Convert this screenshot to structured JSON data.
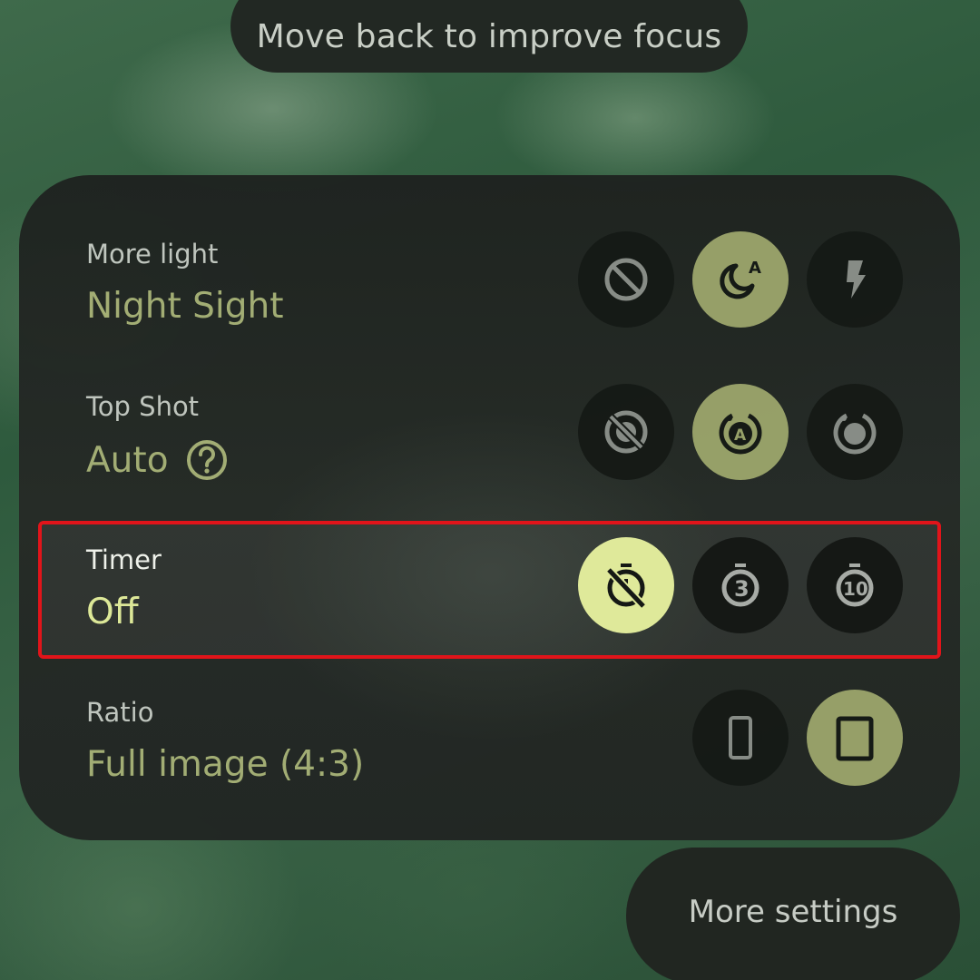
{
  "toast": {
    "text": "Move back to improve focus"
  },
  "settings": {
    "more_light": {
      "label": "More light",
      "value": "Night Sight",
      "options": [
        "off-icon",
        "night-sight-auto-icon",
        "flash-icon"
      ],
      "selected_index": 1
    },
    "top_shot": {
      "label": "Top Shot",
      "value": "Auto",
      "options": [
        "top-shot-off-icon",
        "top-shot-auto-icon",
        "top-shot-on-icon"
      ],
      "selected_index": 1
    },
    "timer": {
      "label": "Timer",
      "value": "Off",
      "options": [
        "timer-off-icon",
        "timer-3s-icon",
        "timer-10s-icon"
      ],
      "selected_index": 0,
      "timer3_glyph": "3",
      "timer10_glyph": "10"
    },
    "ratio": {
      "label": "Ratio",
      "value": "Full image (4:3)",
      "options": [
        "ratio-16-9-icon",
        "ratio-4-3-icon"
      ],
      "selected_index": 1
    }
  },
  "more_settings": {
    "label": "More settings"
  },
  "colors": {
    "accent_selected": "#9aa26a",
    "accent_active": "#dfe99a",
    "highlight_border": "#e1141a"
  }
}
